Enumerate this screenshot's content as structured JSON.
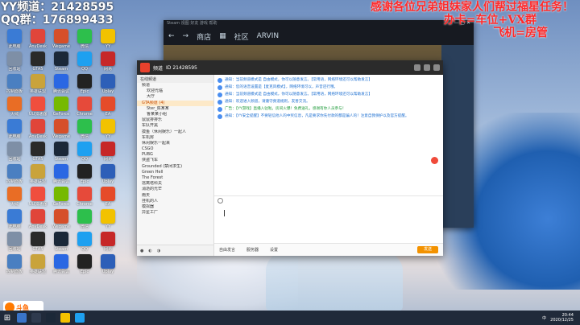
{
  "overlay": {
    "yy_line": "YY频道：2142859⁠5",
    "qq_line": "QQ群：176899433",
    "right_line1": "感谢各位兄弟姐妹家人们帮过福星任务！",
    "right_line2": "办卡=车位+VX群",
    "right_line3": "飞机=房管"
  },
  "desktop_icons": [
    {
      "label": "此电脑",
      "color": "#3a7bd5"
    },
    {
      "label": "AnyDesk",
      "color": "#e0453a"
    },
    {
      "label": "Wegame",
      "color": "#d64f2a"
    },
    {
      "label": "微信",
      "color": "#2dbf4c"
    },
    {
      "label": "YY",
      "color": "#f2c200"
    },
    {
      "label": "回收站",
      "color": "#7e8fa6"
    },
    {
      "label": "GTA5",
      "color": "#2a2a2a"
    },
    {
      "label": "Steam",
      "color": "#1b2838"
    },
    {
      "label": "QQ",
      "color": "#1ea0f0"
    },
    {
      "label": "网易",
      "color": "#c62828"
    },
    {
      "label": "控制面板",
      "color": "#4a7fc1"
    },
    {
      "label": "英雄联盟",
      "color": "#c9a33b"
    },
    {
      "label": "腾讯会议",
      "color": "#2a67e3"
    },
    {
      "label": "Epic",
      "color": "#222222"
    },
    {
      "label": "Uplay",
      "color": "#2d5fb8"
    },
    {
      "label": "火绒",
      "color": "#e96d25"
    },
    {
      "label": "UU加速器",
      "color": "#f04e3e"
    },
    {
      "label": "GeForce",
      "color": "#76b900"
    },
    {
      "label": "Chrome",
      "color": "#e64a3a"
    },
    {
      "label": "EA",
      "color": "#e54b2a"
    }
  ],
  "steam": {
    "top_text": "Steam  视图  好友  游戏  帮助",
    "nav_store": "商店",
    "nav_community": "社区",
    "nav_user": "ARVIN",
    "controls": "— ▢ ✕"
  },
  "yy": {
    "channel_id": "ID 21428595",
    "channel_name": "频道",
    "sidebar_header": "在线频道",
    "channels": [
      {
        "name": "频道",
        "sel": false,
        "sub": false
      },
      {
        "name": "欢迎光临",
        "sel": false,
        "sub": true
      },
      {
        "name": "大厅",
        "sel": false,
        "sub": true
      },
      {
        "name": "GTA频道 (4)",
        "sel": true,
        "sub": false
      },
      {
        "name": "Ster_陈某某",
        "sel": false,
        "sub": true
      },
      {
        "name": "鲁某某小组",
        "sel": false,
        "sub": true
      },
      {
        "name": "鼠鼠排排乐",
        "sel": false,
        "sub": false
      },
      {
        "name": "车队开黑",
        "sel": false,
        "sub": false
      },
      {
        "name": "摸鱼（休闲娱乐）一起人",
        "sel": false,
        "sub": false
      },
      {
        "name": "车机房",
        "sel": false,
        "sub": false
      },
      {
        "name": "休闲娱乐一起来",
        "sel": false,
        "sub": false
      },
      {
        "name": "CSGO",
        "sel": false,
        "sub": false
      },
      {
        "name": "PUBG",
        "sel": false,
        "sub": false
      },
      {
        "name": "侠盗飞车",
        "sel": false,
        "sub": false
      },
      {
        "name": "Grounded (禁闭求生)",
        "sel": false,
        "sub": false
      },
      {
        "name": "Green Hell",
        "sel": false,
        "sub": false
      },
      {
        "name": "The Forest",
        "sel": false,
        "sub": false
      },
      {
        "name": "逃离塔科夫",
        "sel": false,
        "sub": false
      },
      {
        "name": "消逝的光芒",
        "sel": false,
        "sub": false
      },
      {
        "name": "雨天",
        "sel": false,
        "sub": false
      },
      {
        "name": "挂机的人",
        "sel": false,
        "sub": false
      },
      {
        "name": "模拟器",
        "sel": false,
        "sub": false
      },
      {
        "name": "异星工厂",
        "sel": false,
        "sub": false
      }
    ],
    "messages": [
      {
        "text": "通知：当前频道模式是 自由模式，你可以随意发言。【常用语，网络环境还可以帮助发言】",
        "green": false
      },
      {
        "text": "通知：您的语音设置是【麦克风模式】，网络环境可以，声音还行哦。",
        "green": false
      },
      {
        "text": "通知：当前频道模式是 自由模式，你可以随意发言。【常用语，网络环境还可以帮助发言】",
        "green": false
      },
      {
        "text": "通知：欢迎进入频道，请遵守频道规则，友善交流。",
        "green": false
      },
      {
        "text": "广告：【YY游戏】直播入驻啦，房间火爆！免费送礼，感谢有你人员参与！",
        "green": true
      },
      {
        "text": "通知：【YY安全提醒】不要轻信他人的中奖信息，凡是要求你先付款的都是骗人的！注意自我保护以及官方提醒。",
        "green": false
      }
    ],
    "bottom_items": [
      "自由发言",
      "服务器",
      "设置"
    ],
    "send_label": "发送"
  },
  "taskbar": {
    "time": "20:44",
    "date": "2020/12/25",
    "tray": "中"
  },
  "douyu": {
    "label": "斗鱼"
  }
}
